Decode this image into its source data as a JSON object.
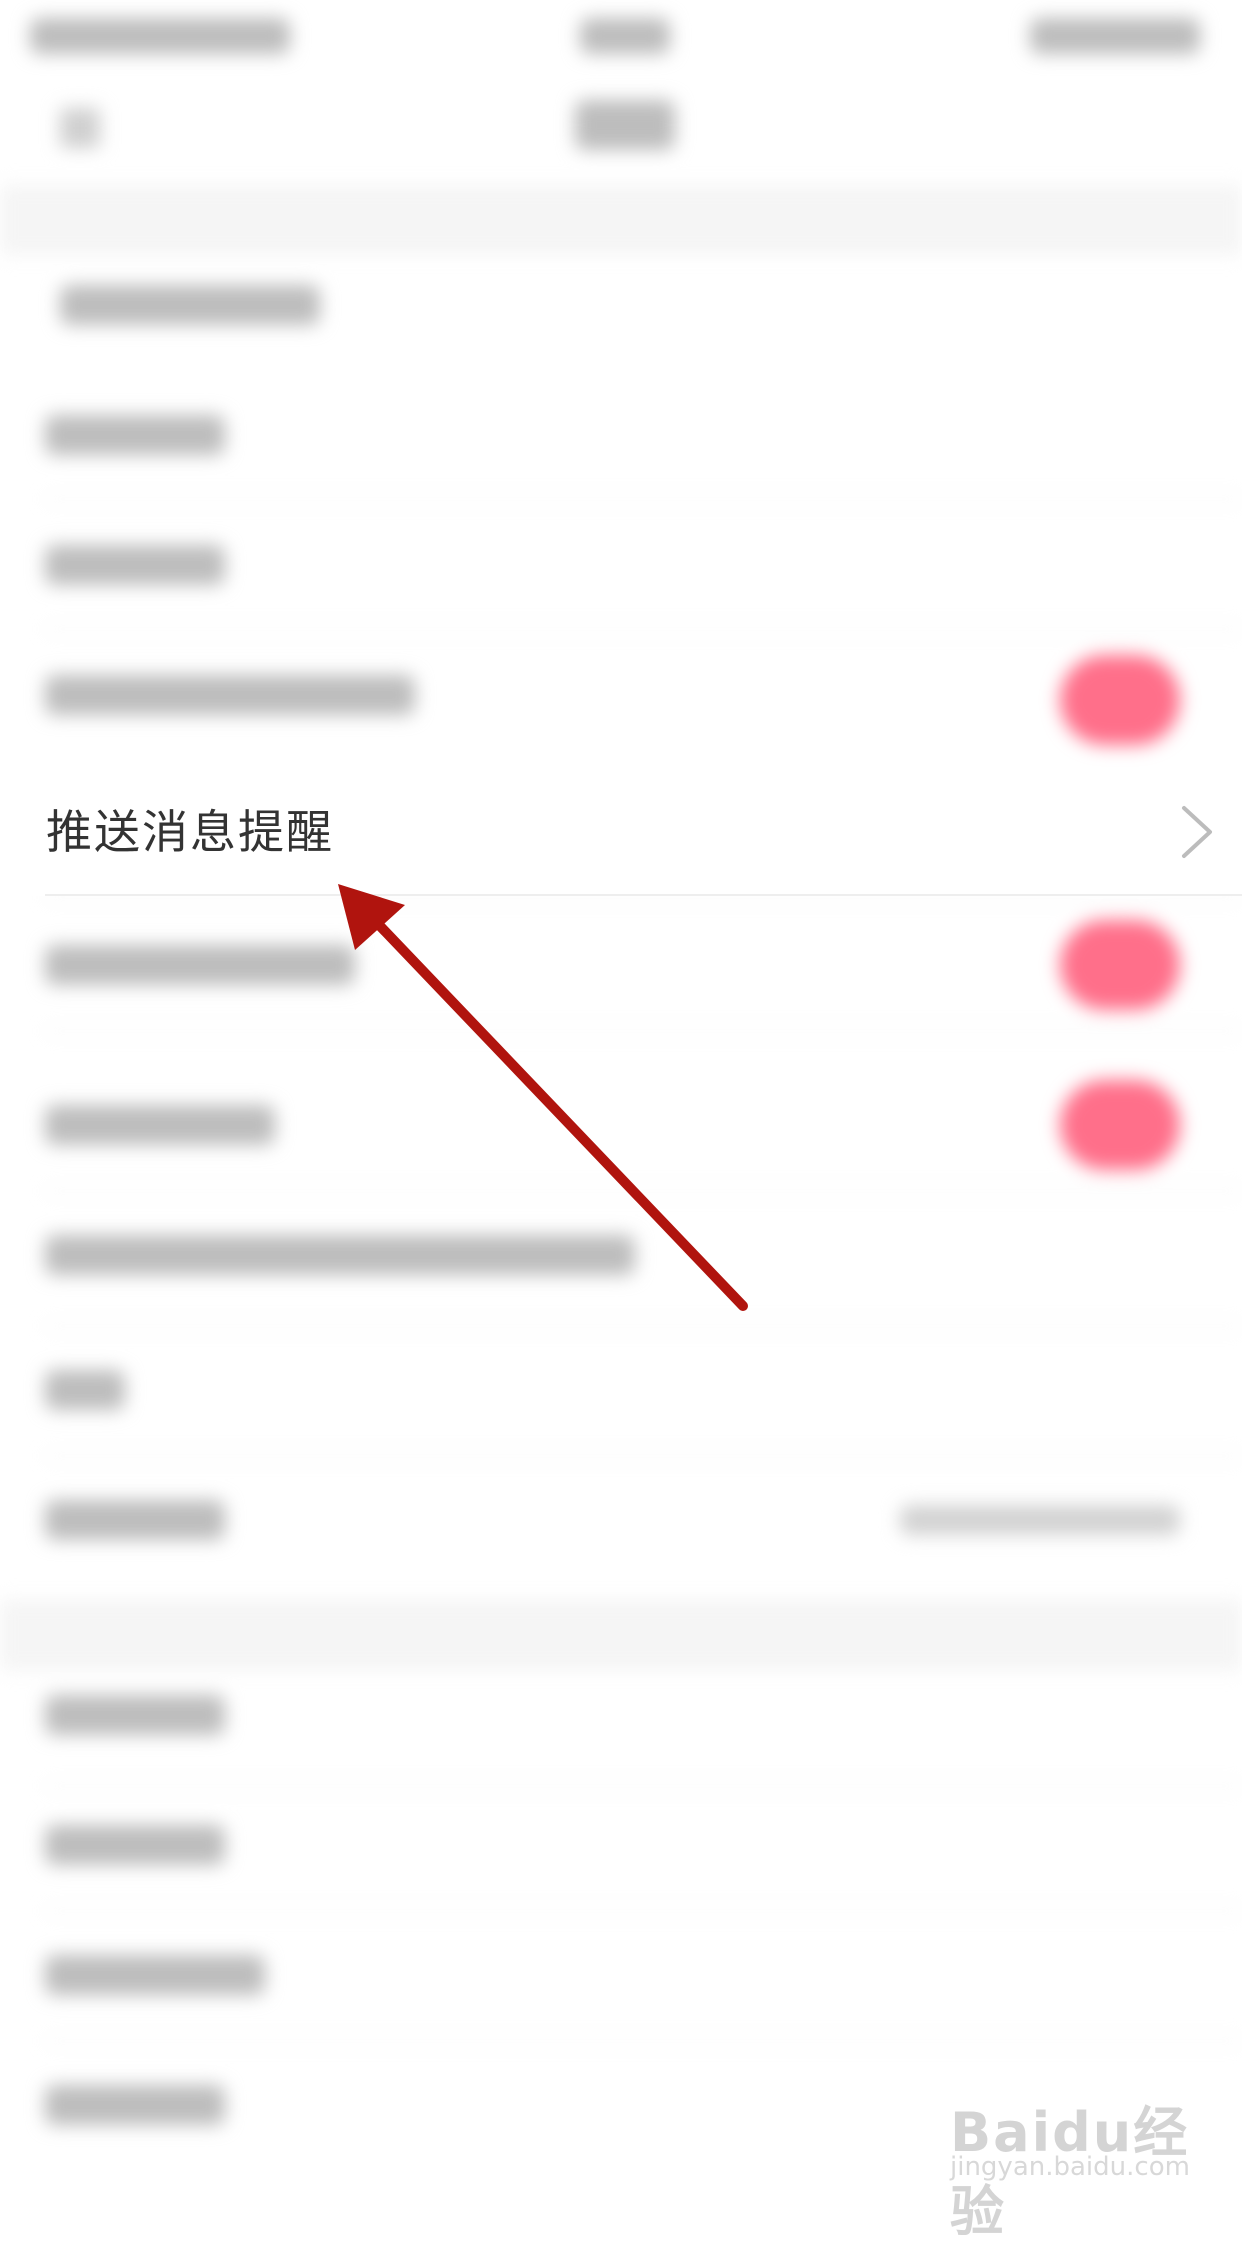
{
  "settings_item": {
    "label": "推送消息提醒"
  },
  "watermark": {
    "brand": "Baidu经验",
    "url": "jingyan.baidu.com"
  },
  "colors": {
    "arrow": "#b0140e",
    "toggle_blurred": "#ff6f8a",
    "text": "#333333"
  }
}
